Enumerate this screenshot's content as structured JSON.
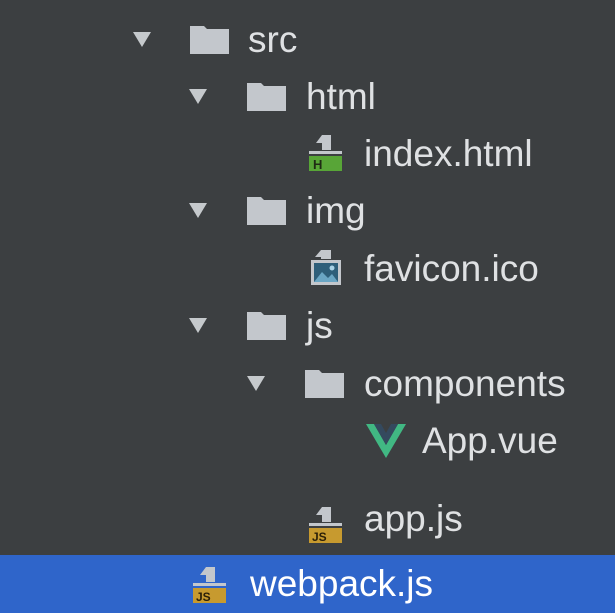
{
  "tree": {
    "items": [
      {
        "label": "src",
        "type": "folder",
        "expanded": true,
        "depth": 0,
        "selected": false
      },
      {
        "label": "html",
        "type": "folder",
        "expanded": true,
        "depth": 1,
        "selected": false
      },
      {
        "label": "index.html",
        "type": "file",
        "icon": "html-file-icon",
        "depth": 2,
        "selected": false
      },
      {
        "label": "img",
        "type": "folder",
        "expanded": true,
        "depth": 1,
        "selected": false
      },
      {
        "label": "favicon.ico",
        "type": "file",
        "icon": "image-file-icon",
        "depth": 2,
        "selected": false
      },
      {
        "label": "js",
        "type": "folder",
        "expanded": true,
        "depth": 1,
        "selected": false
      },
      {
        "label": "components",
        "type": "folder",
        "expanded": true,
        "depth": 2,
        "selected": false
      },
      {
        "label": "App.vue",
        "type": "file",
        "icon": "vue-file-icon",
        "depth": 3,
        "selected": false
      },
      {
        "label": "app.js",
        "type": "file",
        "icon": "js-file-icon",
        "depth": 2,
        "selected": false
      },
      {
        "label": "webpack.js",
        "type": "file",
        "icon": "js-file-icon",
        "depth": 0,
        "selected": true
      }
    ],
    "icon_badges": {
      "html": "H",
      "js": "JS"
    }
  },
  "colors": {
    "background": "#3c3f41",
    "selection": "#2f65ca",
    "text": "#dfe1e3",
    "folder": "#c3c7cc",
    "html_badge": "#58a537",
    "js_badge": "#c79a2f",
    "vue_green": "#41b883",
    "vue_dark": "#34495e"
  }
}
